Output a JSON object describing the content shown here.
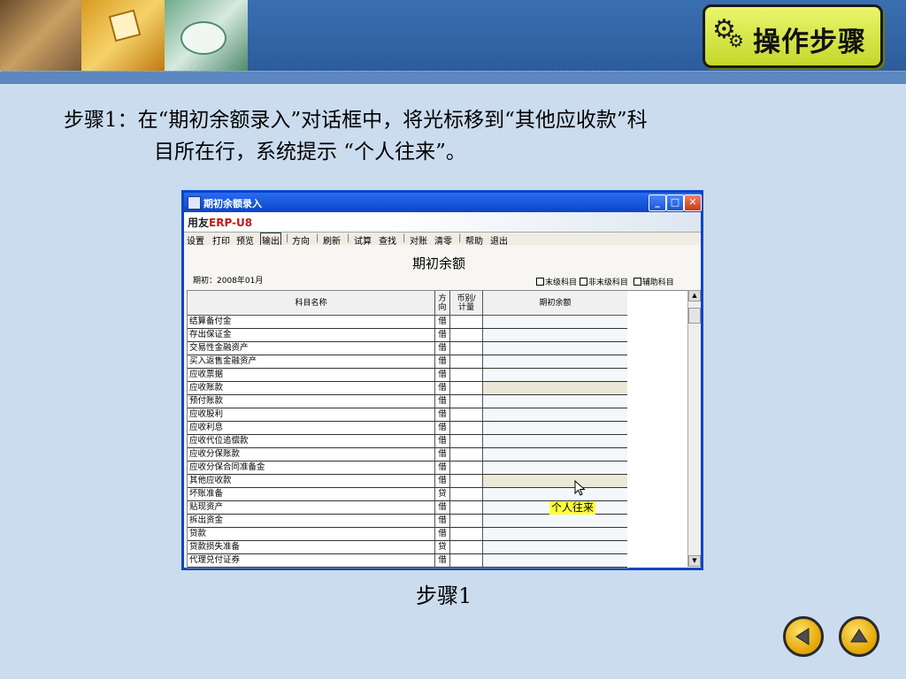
{
  "header": {
    "steps_button": "操作步骤"
  },
  "instruction": {
    "line1": "步骤1：在“期初余额录入”对话框中，将光标移到“其他应收款”科",
    "line2": "目所在行，系统提示 “个人往来”。"
  },
  "caption": "步骤1",
  "dialog": {
    "title": "期初余额录入",
    "logo": {
      "brand": "用友",
      "product": "ERP",
      "suffix": "-U8"
    },
    "toolbar": [
      {
        "label": "设置"
      },
      {
        "label": "打印"
      },
      {
        "label": "预览"
      },
      {
        "label": "输出"
      },
      {
        "label": "方向"
      },
      {
        "label": "刷新"
      },
      {
        "label": "试算"
      },
      {
        "label": "查找"
      },
      {
        "label": "对账"
      },
      {
        "label": "清零"
      },
      {
        "label": "帮助"
      },
      {
        "label": "退出"
      }
    ],
    "content_title": "期初余额",
    "period": "期初：2008年01月",
    "legend": {
      "final": "末级科目",
      "non_final": "非末级科目",
      "aux": "辅助科目"
    },
    "columns": {
      "name": "科目名称",
      "dir1": "方",
      "dir2": "向",
      "cur1": "币别/",
      "cur2": "计量",
      "amount": "期初余额"
    },
    "rows": [
      {
        "name": "结算备付金",
        "dir": "借"
      },
      {
        "name": "存出保证金",
        "dir": "借"
      },
      {
        "name": "交易性金融资产",
        "dir": "借"
      },
      {
        "name": "买入返售金融资产",
        "dir": "借"
      },
      {
        "name": "应收票据",
        "dir": "借"
      },
      {
        "name": "应收账款",
        "dir": "借",
        "highlight": true
      },
      {
        "name": "预付账款",
        "dir": "借"
      },
      {
        "name": "应收股利",
        "dir": "借"
      },
      {
        "name": "应收利息",
        "dir": "借"
      },
      {
        "name": "应收代位追偿款",
        "dir": "借"
      },
      {
        "name": "应收分保账款",
        "dir": "借"
      },
      {
        "name": "应收分保合同准备金",
        "dir": "借"
      },
      {
        "name": "其他应收款",
        "dir": "借",
        "highlight": true
      },
      {
        "name": "坏账准备",
        "dir": "贷"
      },
      {
        "name": "贴现资产",
        "dir": "借"
      },
      {
        "name": "拆出资金",
        "dir": "借"
      },
      {
        "name": "贷款",
        "dir": "借"
      },
      {
        "name": "贷款损失准备",
        "dir": "贷"
      },
      {
        "name": "代理兑付证券",
        "dir": "借"
      }
    ],
    "tooltip": "个人往来"
  },
  "nav": {
    "back_icon": "triangle-left-icon",
    "home_icon": "triangle-up-icon"
  }
}
